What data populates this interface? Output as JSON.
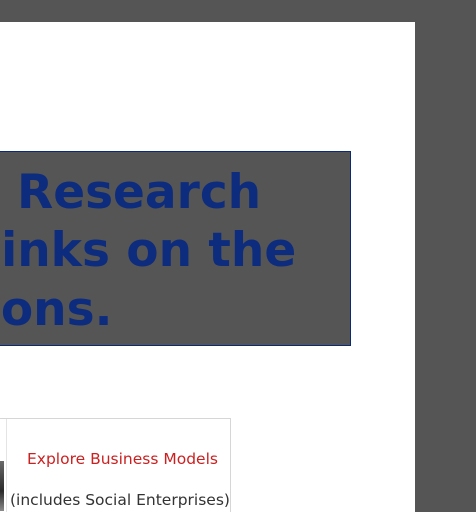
{
  "banner": {
    "line1": "Research",
    "line2": "links on the",
    "line3": "cons."
  },
  "card": {
    "link_label": "Explore Business Models",
    "subtitle": "(includes Social Enterprises)"
  },
  "colors": {
    "background": "#555555",
    "page": "#ffffff",
    "banner_text": "#0d2c7e",
    "link": "#cc1f1f"
  }
}
